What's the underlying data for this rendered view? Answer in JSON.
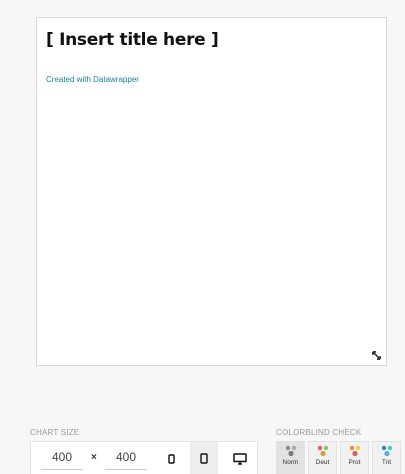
{
  "preview": {
    "chart_title": "[ Insert title here ]",
    "credit": "Created with Datawrapper"
  },
  "chart_size": {
    "label": "CHART SIZE",
    "width_value": "400",
    "times_symbol": "×",
    "height_value": "400"
  },
  "colorblind": {
    "label": "COLORBLIND CHECK",
    "modes": [
      {
        "name": "Norm",
        "colors": [
          "#8c8c8c",
          "#a9a9a9",
          "#7a7a7a"
        ]
      },
      {
        "name": "Deut",
        "colors": [
          "#e06060",
          "#8fbf6a",
          "#d4a03c"
        ]
      },
      {
        "name": "Prot",
        "colors": [
          "#e5893a",
          "#f2c94c",
          "#d95f5f"
        ]
      },
      {
        "name": "Trit",
        "colors": [
          "#2e86c1",
          "#48c9b0",
          "#5dade2"
        ]
      }
    ]
  },
  "colors": {
    "link": "#1d81a2",
    "muted_label": "#999999"
  }
}
